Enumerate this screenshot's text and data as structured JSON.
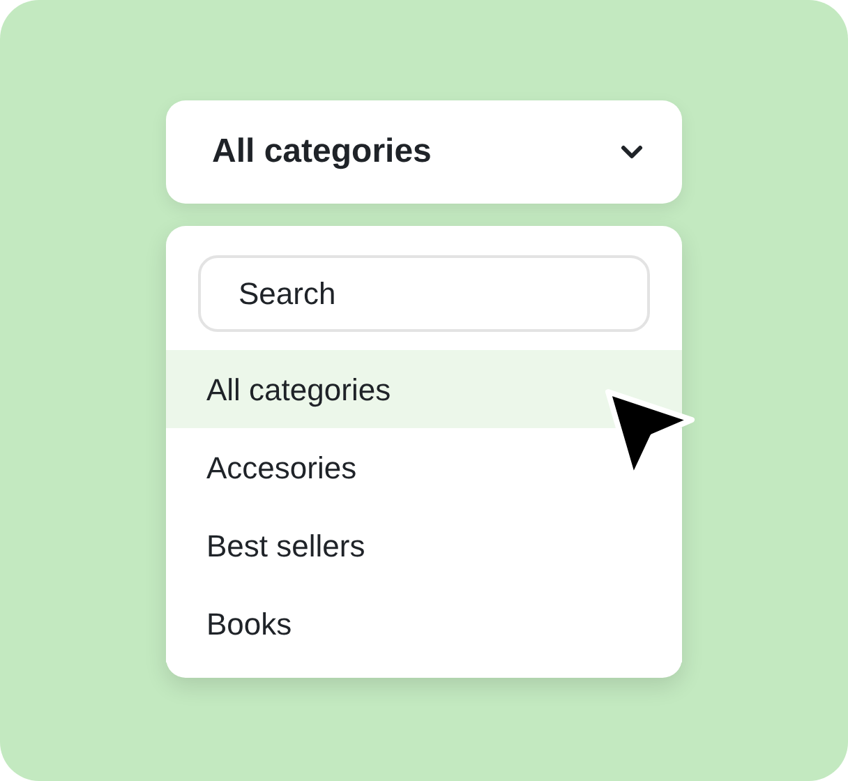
{
  "dropdown": {
    "label": "All categories"
  },
  "search": {
    "placeholder": "Search"
  },
  "items": [
    {
      "label": "All categories",
      "selected": true
    },
    {
      "label": "Accesories",
      "selected": false
    },
    {
      "label": "Best sellers",
      "selected": false
    },
    {
      "label": "Books",
      "selected": false
    }
  ]
}
